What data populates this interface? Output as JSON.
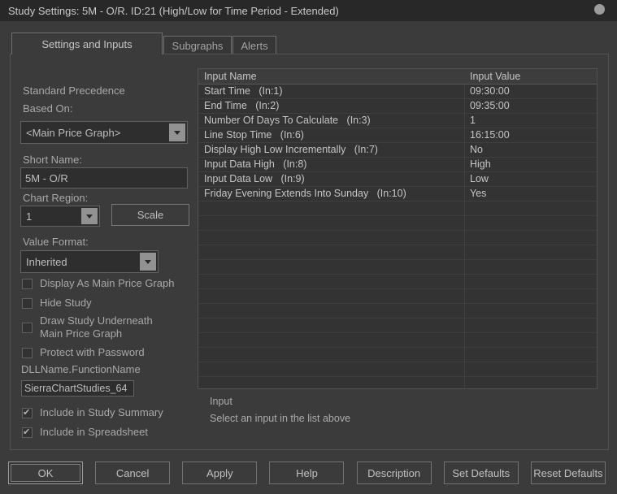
{
  "window": {
    "title": "Study Settings: 5M - O/R. ID:21 (High/Low for Time Period - Extended)"
  },
  "tabs": [
    {
      "label": "Settings and Inputs",
      "active": true
    },
    {
      "label": "Subgraphs",
      "active": false
    },
    {
      "label": "Alerts",
      "active": false
    }
  ],
  "left_panel": {
    "precedence_label": "Standard Precedence",
    "based_on_label": "Based On:",
    "based_on_value": "<Main Price Graph>",
    "short_name_label": "Short Name:",
    "short_name_value": "5M - O/R",
    "chart_region_label": "Chart Region:",
    "chart_region_value": "1",
    "scale_button_label": "Scale",
    "value_format_label": "Value Format:",
    "value_format_value": "Inherited",
    "checkboxes": [
      {
        "label": "Display As Main Price Graph",
        "checked": false
      },
      {
        "label": "Hide Study",
        "checked": false
      },
      {
        "label": "Draw Study Underneath\nMain Price Graph",
        "checked": false
      },
      {
        "label": "Protect with Password",
        "checked": false
      }
    ],
    "dll_label": "DLLName.FunctionName",
    "dll_value": "SierraChartStudies_64",
    "summary_checkboxes": [
      {
        "label": "Include in Study Summary",
        "checked": true
      },
      {
        "label": "Include in Spreadsheet",
        "checked": true
      }
    ]
  },
  "inputs_table": {
    "columns": [
      "Input Name",
      "Input Value"
    ],
    "rows": [
      {
        "name": "Start Time   (In:1)",
        "value": "09:30:00"
      },
      {
        "name": "End Time   (In:2)",
        "value": "09:35:00"
      },
      {
        "name": "Number Of Days To Calculate   (In:3)",
        "value": "1"
      },
      {
        "name": "Line Stop Time   (In:6)",
        "value": "16:15:00"
      },
      {
        "name": "Display High Low Incrementally   (In:7)",
        "value": "No"
      },
      {
        "name": "Input Data High   (In:8)",
        "value": "High"
      },
      {
        "name": "Input Data Low   (In:9)",
        "value": "Low"
      },
      {
        "name": "Friday Evening Extends Into Sunday   (In:10)",
        "value": "Yes"
      }
    ],
    "empty_row_count": 14
  },
  "input_section": {
    "label": "Input",
    "hint": "Select an input in the list above"
  },
  "action_buttons": [
    "OK",
    "Cancel",
    "Apply",
    "Help",
    "Description",
    "Set Defaults",
    "Reset Defaults"
  ]
}
